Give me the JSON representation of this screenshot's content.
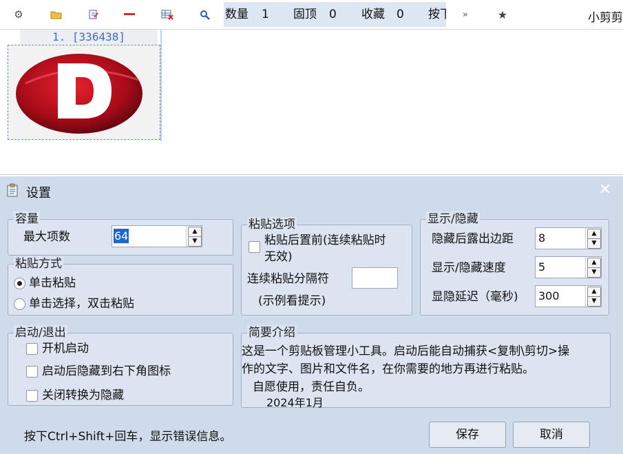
{
  "toolbar": {
    "icons": [
      "gear-icon",
      "folder-open-icon",
      "edit-file-icon",
      "minus-icon",
      "delete-table-icon",
      "search-icon",
      "chevron-right-icon",
      "star-icon"
    ],
    "count_label": "数量",
    "count_value": "1",
    "pinned_label": "固顶",
    "pinned_value": "0",
    "fav_label": "收藏",
    "fav_value": "0",
    "press_label": "按下",
    "app_title": "小剪剪"
  },
  "clips": [
    {
      "title": "1. [336438]"
    }
  ],
  "dialog": {
    "title": "设置",
    "capacity": {
      "title": "容量",
      "max_items_label": "最大项数",
      "max_items_value": "64"
    },
    "paste_mode": {
      "title": "粘贴方式",
      "single_click": "单击粘贴",
      "click_double": "单击选择，双击粘贴"
    },
    "paste_options": {
      "title": "粘贴选项",
      "topmost_line1": "粘贴后置前(连续粘贴时",
      "topmost_line2": "无效)",
      "separator_label": "连续粘贴分隔符",
      "separator_value": "",
      "example_hint": "(示例看提示)"
    },
    "show_hide": {
      "title": "显示/隐藏",
      "margin_label": "隐藏后露出边距",
      "margin_value": "8",
      "speed_label": "显示/隐藏速度",
      "speed_value": "5",
      "delay_label": "显隐延迟（毫秒)",
      "delay_value": "300"
    },
    "startup": {
      "title": "启动/退出",
      "autostart": "开机启动",
      "hide_tray": "启动后隐藏到右下角图标",
      "close_hide": "关闭转换为隐藏"
    },
    "about": {
      "title": "简要介绍",
      "line1": "这是一个剪贴板管理小工具。启动后能自动捕获<复制\\剪切>操",
      "line2": "作的文字、图片和文件名，在你需要的地方再进行粘贴。",
      "line3": "自愿使用，责任自负。",
      "line4": "2024年1月"
    },
    "hint": "按下Ctrl+Shift+回车，显示错误信息。",
    "save_label": "保存",
    "cancel_label": "取消"
  },
  "colors": {
    "accent": "#3a6fc4",
    "dialog_bg": "#cfdaea",
    "logo_red": "#c0101e"
  }
}
